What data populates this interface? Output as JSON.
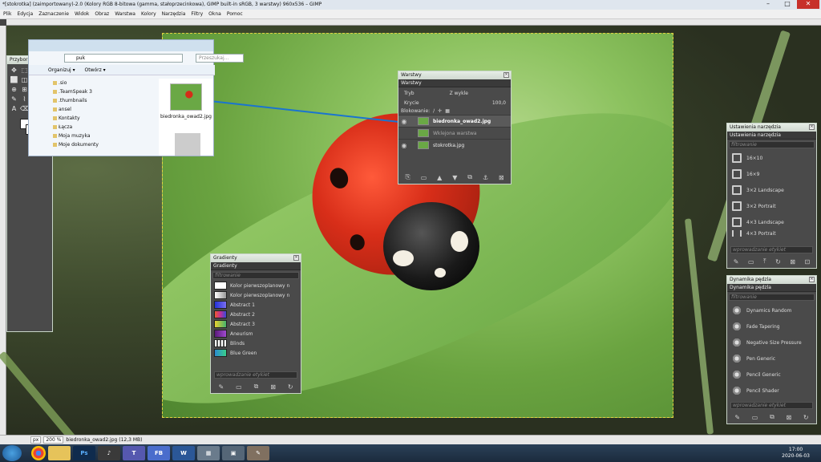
{
  "titlebar": {
    "title": "*[stokrotka] (zaimportowany)-2.0 (Kolory RGB 8-bitowa (gamma, stałoprzecinkowa), GIMP built-in sRGB, 3 warstwy) 960x536 – GIMP",
    "min": "–",
    "max": "□",
    "close": "✕"
  },
  "menu": {
    "items": [
      "Plik",
      "Edycja",
      "Zaznaczenie",
      "Widok",
      "Obraz",
      "Warstwa",
      "Kolory",
      "Narzędzia",
      "Filtry",
      "Okna",
      "Pomoc"
    ]
  },
  "toolbox": {
    "title": "Przybornik",
    "tools": [
      "✥",
      "⬚",
      "◌",
      "↯",
      "⬜",
      "◫",
      "⬒",
      "⤢",
      "⊕",
      "⊞",
      "✂",
      "◐",
      "✎",
      "⌇",
      "∕",
      "◍",
      "A",
      "⌫",
      "✦",
      "▣"
    ]
  },
  "explorer": {
    "path": "puk",
    "search": "Przeszukaj...",
    "cmd_organize": "Organizuj ▾",
    "cmd_open": "Otwórz ▾",
    "nav": [
      ".sio",
      ".TeamSpeak 3",
      ".thumbnails",
      "ansel",
      "Kontakty",
      "Łącza",
      "Moja muzyka",
      "Moje dokumenty"
    ],
    "file_name": "biedronka_owad2.jpg"
  },
  "layers": {
    "title": "Warstwy",
    "tab": "Warstwy",
    "mode_label": "Tryb",
    "mode_value": "Z wykle",
    "opacity_label": "Krycie",
    "opacity_value": "100,0",
    "lock_label": "Blokowanie:",
    "items": [
      {
        "name": "biedronka_owad2.jpg",
        "style": "bold"
      },
      {
        "name": "Wklejona warstwa",
        "style": "dim"
      },
      {
        "name": "stokrotka.jpg",
        "style": "normal"
      }
    ]
  },
  "gradients": {
    "title": "Gradienty",
    "tab": "Gradienty",
    "filter": "filtrowanie",
    "tags": "wprowadzanie etykiet",
    "items": [
      {
        "name": "Kolor pierwszoplanowy n",
        "color": "#ffffff"
      },
      {
        "name": "Kolor pierwszoplanowy n",
        "color": "#bbbbbb"
      },
      {
        "name": "Abstract 1",
        "color": "#3b52e0"
      },
      {
        "name": "Abstract 2",
        "color": "#e0407a"
      },
      {
        "name": "Abstract 3",
        "color": "#46b36c"
      },
      {
        "name": "Aneurism",
        "color": "#7a2fa0"
      },
      {
        "name": "Blinds",
        "color": "#999999"
      },
      {
        "name": "Blue Green",
        "color": "#2a8ad0"
      }
    ]
  },
  "tool_options": {
    "title": "Ustawienia narzędzia",
    "tab": "Ustawienia narzędzia",
    "filter": "filtrowanie",
    "tags": "wprowadzanie etykiet",
    "items": [
      "16×10",
      "16×9",
      "3×2 Landscape",
      "3×2 Portrait",
      "4×3 Landscape",
      "4×3 Portrait"
    ]
  },
  "brush_dynamics": {
    "title": "Dynamika pędzla",
    "tab": "Dynamika pędzla",
    "filter": "filtrowanie",
    "tags": "wprowadzanie etykiet",
    "items": [
      "Dynamics Random",
      "Fade Tapering",
      "Negative Size Pressure",
      "Pen Generic",
      "Pencil Generic",
      "Pencil Shader"
    ]
  },
  "statusbar": {
    "unit": "px",
    "zoom": "200 %",
    "info": "biedronka_owad2.jpg (12,3 MB)"
  },
  "taskbar": {
    "time": "17:00",
    "date": "2020-06-03"
  },
  "colors": {
    "accent": "#1a74d0",
    "panel": "#4a4a4a",
    "ladybug": "#d82e19"
  }
}
